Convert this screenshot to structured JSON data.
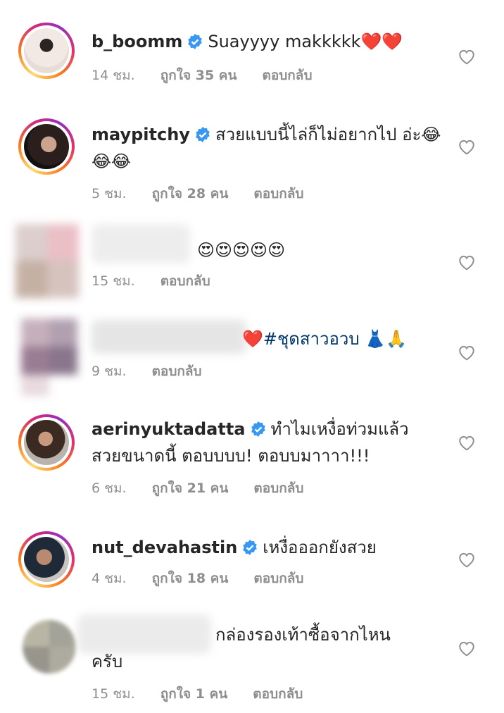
{
  "comments": [
    {
      "user": "b_boomm",
      "verified": true,
      "text": "Suayyyy makkkkk❤️❤️",
      "time": "14 ชม.",
      "likes": "ถูกใจ 35 คน",
      "reply": "ตอบกลับ"
    },
    {
      "user": "maypitchy",
      "verified": true,
      "text": "สวยแบบนี้ไล่ก็ไม่อยากไป อ่ะ😂😂😂",
      "time": "5 ชม.",
      "likes": "ถูกใจ 28 คน",
      "reply": "ตอบกลับ"
    },
    {
      "user": "",
      "verified": false,
      "text": "😍😍😍😍😍",
      "time": "15 ชม.",
      "likes": "",
      "reply": "ตอบกลับ"
    },
    {
      "user": "",
      "verified": false,
      "text": "❤️",
      "hashtag": "#ชุดสาวอวบ",
      "text_tail": "👗🙏",
      "time": "9 ชม.",
      "likes": "",
      "reply": "ตอบกลับ"
    },
    {
      "user": "aerinyuktadatta",
      "verified": true,
      "text": "ทำไมเหงื่อท่วมแล้ว สวยขนาดนี้ ตอบบบบ! ตอบบมาาาา!!!",
      "time": "6 ชม.",
      "likes": "ถูกใจ 21 คน",
      "reply": "ตอบกลับ"
    },
    {
      "user": "nut_devahastin",
      "verified": true,
      "text": "เหงื่อออกยังสวย",
      "time": "4 ชม.",
      "likes": "ถูกใจ 18 คน",
      "reply": "ตอบกลับ"
    },
    {
      "user": "",
      "verified": false,
      "text": "กล่องรองเท้าซื้อจากไหน ครับ",
      "time": "15 ชม.",
      "likes": "ถูกใจ 1 คน",
      "reply": "ตอบกลับ"
    }
  ],
  "colors": {
    "text": "#262626",
    "meta": "#8e8e8e",
    "verified": "#3897f0",
    "hashtag": "#00376b"
  },
  "icons": {
    "like": "heart-outline-icon",
    "verified": "verified-badge-icon"
  }
}
